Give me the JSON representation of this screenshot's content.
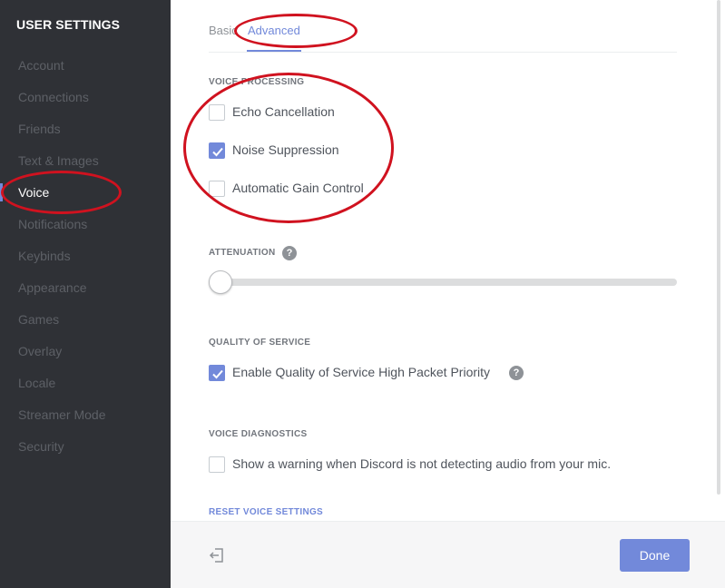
{
  "sidebar": {
    "title": "USER SETTINGS",
    "items": [
      {
        "label": "Account"
      },
      {
        "label": "Connections"
      },
      {
        "label": "Friends"
      },
      {
        "label": "Text & Images"
      },
      {
        "label": "Voice"
      },
      {
        "label": "Notifications"
      },
      {
        "label": "Keybinds"
      },
      {
        "label": "Appearance"
      },
      {
        "label": "Games"
      },
      {
        "label": "Overlay"
      },
      {
        "label": "Locale"
      },
      {
        "label": "Streamer Mode"
      },
      {
        "label": "Security"
      }
    ],
    "active_item": "Voice"
  },
  "tabs": {
    "basic": "Basic",
    "advanced": "Advanced",
    "active": "Advanced"
  },
  "voice_processing": {
    "label": "VOICE PROCESSING",
    "options": [
      {
        "label": "Echo Cancellation",
        "checked": false
      },
      {
        "label": "Noise Suppression",
        "checked": true
      },
      {
        "label": "Automatic Gain Control",
        "checked": false
      }
    ]
  },
  "attenuation": {
    "label": "ATTENUATION",
    "help_icon": "?",
    "value_percent": 0
  },
  "quality_of_service": {
    "label": "QUALITY OF SERVICE",
    "option": {
      "label": "Enable Quality of Service High Packet Priority",
      "checked": true
    },
    "help_icon": "?"
  },
  "voice_diagnostics": {
    "label": "VOICE DIAGNOSTICS",
    "option": {
      "label": "Show a warning when Discord is not detecting audio from your mic.",
      "checked": false
    }
  },
  "reset_label": "RESET VOICE SETTINGS",
  "footer": {
    "done_label": "Done",
    "exit_icon": "exit-icon"
  },
  "colors": {
    "accent": "#7289da",
    "sidebar_bg": "#2f3136",
    "annotation": "#d0121f"
  }
}
